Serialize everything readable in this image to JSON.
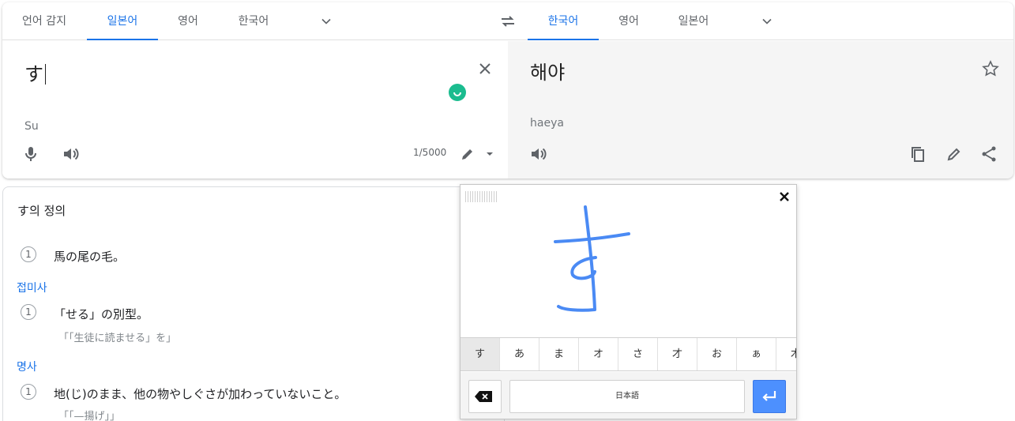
{
  "source_langs": [
    "언어 감지",
    "일본어",
    "영어",
    "한국어"
  ],
  "target_langs": [
    "한국어",
    "영어",
    "일본어"
  ],
  "source": {
    "text": "す",
    "romanization": "Su",
    "char_count": "1/5000"
  },
  "target": {
    "text": "해야",
    "romanization": "haeya"
  },
  "definitions": {
    "title": "す의 정의",
    "entries": [
      {
        "num": "1",
        "text": "馬の尾の毛。"
      },
      {
        "pos": "접미사",
        "num": "1",
        "text": "「せる」の別型。",
        "example": "「「生徒に読ませる」を」"
      },
      {
        "pos": "명사",
        "num": "1",
        "text": "地(じ)のまま、他の物やしぐさが加わっていないこと。",
        "example": "「「—揚げ」」"
      }
    ]
  },
  "handwriting": {
    "candidates": [
      "す",
      "あ",
      "ま",
      "オ",
      "さ",
      "才",
      "お",
      "ぁ",
      "木"
    ],
    "space_label": "日本語"
  },
  "colors": {
    "accent": "#1a73e8",
    "stroke": "#4a8af4",
    "enter": "#4d90fe"
  }
}
